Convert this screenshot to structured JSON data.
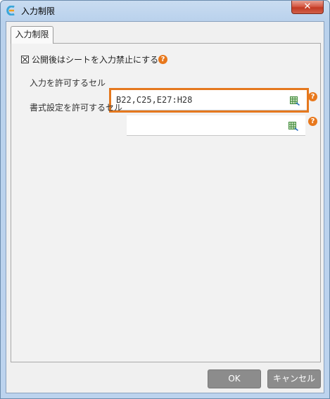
{
  "window": {
    "title": "入力制限",
    "close_label": "✕"
  },
  "tabs": [
    {
      "label": "入力制限"
    }
  ],
  "form": {
    "lock_checkbox_label": "公開後はシートを入力禁止にする",
    "lock_checked": true,
    "allowed_input_cells_label": "入力を許可するセル",
    "allowed_input_cells_value": "B22,C25,E27:H28",
    "allowed_format_cells_label": "書式設定を許可するセル",
    "allowed_format_cells_value": "",
    "help_icon_glyph": "?"
  },
  "footer": {
    "ok_label": "OK",
    "cancel_label": "キャンセル"
  },
  "colors": {
    "highlight": "#e5781e",
    "help": "#e8781c",
    "button": "#8c8c8c",
    "close": "#c23a23"
  }
}
